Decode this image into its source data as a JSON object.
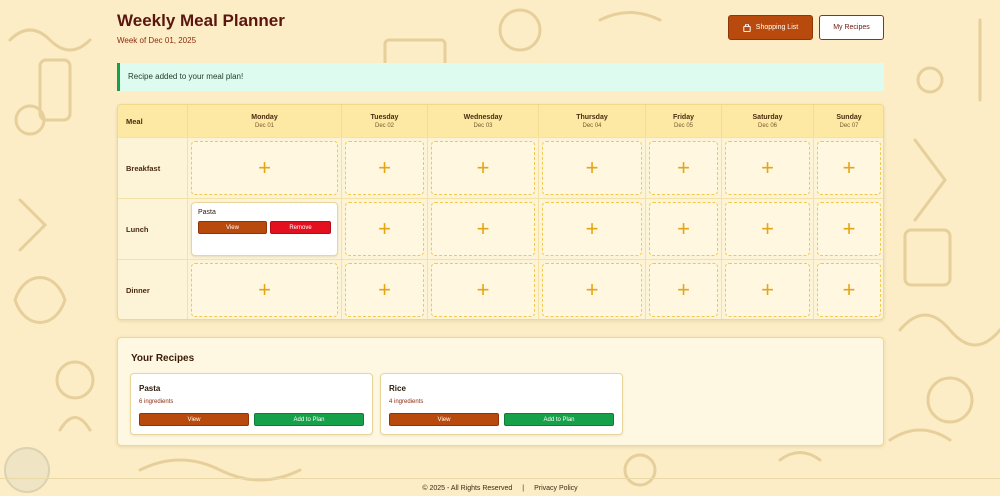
{
  "header": {
    "title": "Weekly Meal Planner",
    "week_label": "Week of Dec 01, 2025",
    "shopping_list_label": "Shopping List",
    "my_recipes_label": "My Recipes"
  },
  "alert": {
    "message": "Recipe added to your meal plan!",
    "color": "#17a04a"
  },
  "planner": {
    "meal_header": "Meal",
    "days": [
      {
        "name": "Monday",
        "date": "Dec 01"
      },
      {
        "name": "Tuesday",
        "date": "Dec 02"
      },
      {
        "name": "Wednesday",
        "date": "Dec 03"
      },
      {
        "name": "Thursday",
        "date": "Dec 04"
      },
      {
        "name": "Friday",
        "date": "Dec 05"
      },
      {
        "name": "Saturday",
        "date": "Dec 06"
      },
      {
        "name": "Sunday",
        "date": "Dec 07"
      }
    ],
    "meals": [
      "Breakfast",
      "Lunch",
      "Dinner"
    ],
    "add_icon": "+",
    "assigned": {
      "meal": "Pasta",
      "view_label": "View",
      "remove_label": "Remove"
    }
  },
  "recipes": {
    "title": "Your Recipes",
    "items": [
      {
        "name": "Pasta",
        "ingredients": "6 ingredients",
        "view_label": "View",
        "add_label": "Add to Plan"
      },
      {
        "name": "Rice",
        "ingredients": "4 ingredients",
        "view_label": "View",
        "add_label": "Add to Plan"
      }
    ]
  },
  "footer": {
    "copyright": "© 2025 - All Rights Reserved",
    "separator": "|",
    "privacy_label": "Privacy Policy"
  },
  "colors": {
    "brand": "#b84a0d",
    "title": "#5a1510",
    "background": "#fcedc6",
    "add_accent": "#e4a516",
    "danger": "#e3101f",
    "success": "#17a04a"
  }
}
